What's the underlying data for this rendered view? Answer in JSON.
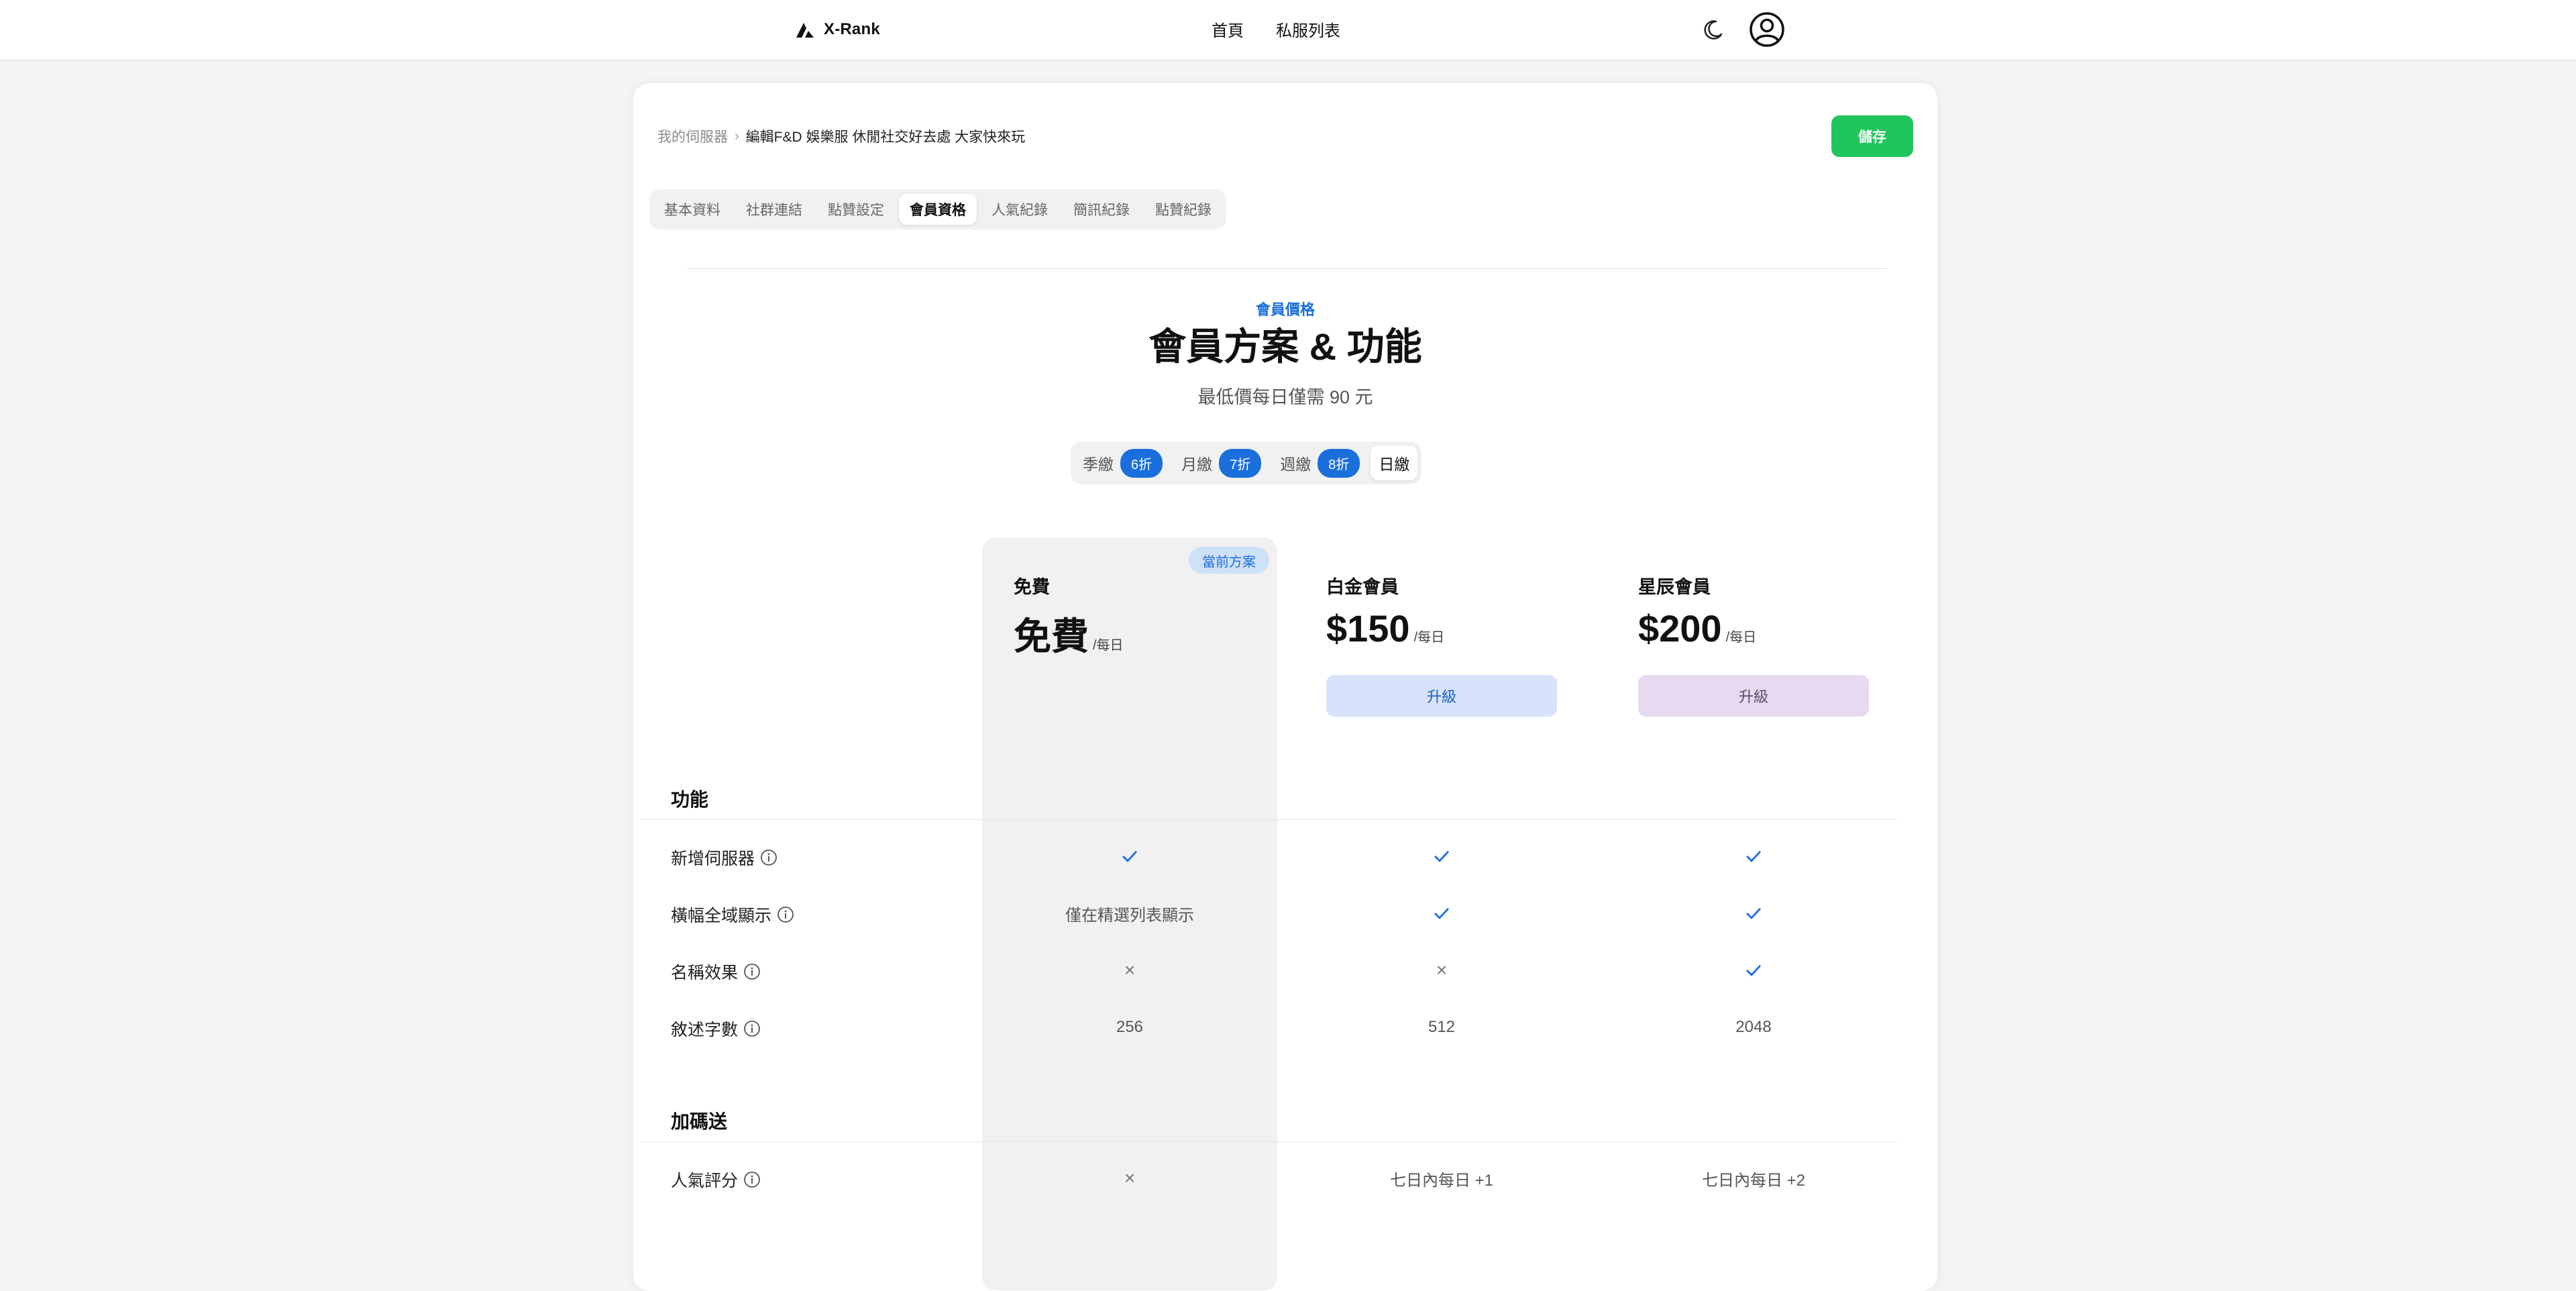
{
  "nav": {
    "brand": "X-Rank",
    "links": [
      "首頁",
      "私服列表"
    ],
    "icons": [
      "moon-icon",
      "user-icon"
    ]
  },
  "breadcrumb": {
    "parent": "我的伺服器",
    "current": "編輯F&D 娛樂服 休閒社交好去處 大家快來玩"
  },
  "save_label": "儲存",
  "tabs": [
    "基本資料",
    "社群連結",
    "點贊設定",
    "會員資格",
    "人氣紀錄",
    "簡訊紀錄",
    "點贊紀錄"
  ],
  "active_tab": "會員資格",
  "pricing": {
    "eyebrow": "會員價格",
    "title": "會員方案 & 功能",
    "subtitle": "最低價每日僅需 90 元",
    "billing_options": [
      {
        "label": "季繳",
        "badge": "6折"
      },
      {
        "label": "月繳",
        "badge": "7折"
      },
      {
        "label": "週繳",
        "badge": "8折"
      },
      {
        "label": "日繳",
        "badge": ""
      }
    ],
    "active_billing": "日繳"
  },
  "plans": [
    {
      "name": "免費",
      "price": "免費",
      "unit": "/每日",
      "badge": "當前方案",
      "button": ""
    },
    {
      "name": "白金會員",
      "price": "$150",
      "unit": "/每日",
      "badge": "",
      "button": "升級"
    },
    {
      "name": "星辰會員",
      "price": "$200",
      "unit": "/每日",
      "badge": "",
      "button": "升級"
    }
  ],
  "sections": [
    {
      "title": "功能",
      "rows": [
        {
          "label": "新增伺服器",
          "values": [
            "check",
            "check",
            "check"
          ]
        },
        {
          "label": "橫幅全域顯示",
          "values": [
            "僅在精選列表顯示",
            "check",
            "check"
          ]
        },
        {
          "label": "名稱效果",
          "values": [
            "cross",
            "cross",
            "check"
          ]
        },
        {
          "label": "敘述字數",
          "values": [
            "256",
            "512",
            "2048"
          ]
        }
      ]
    },
    {
      "title": "加碼送",
      "rows": [
        {
          "label": "人氣評分",
          "values": [
            "cross",
            "七日內每日 +1",
            "七日內每日 +2"
          ]
        }
      ]
    }
  ],
  "colors": {
    "accent": "#1a6fdc",
    "save": "#20c55d",
    "platinum_button": "#d6e3fb",
    "star_button": "#e6d9f0"
  }
}
